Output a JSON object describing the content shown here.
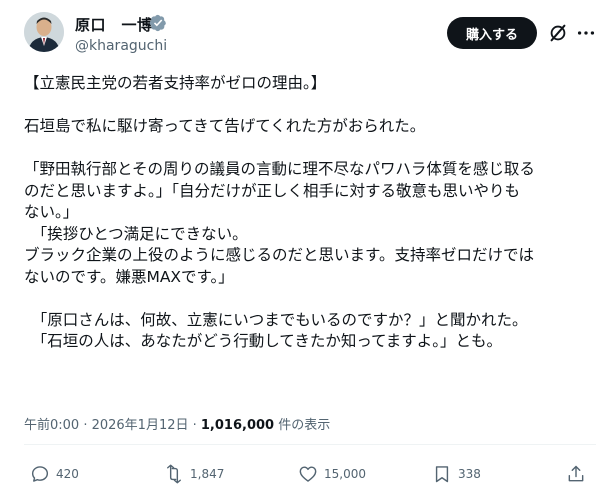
{
  "author": {
    "name": "原口　一博",
    "handle": "@kharaguchi"
  },
  "header": {
    "buy_label": "購入する"
  },
  "post": {
    "lines": [
      "【立憲民主党の若者支持率がゼロの理由。】",
      "",
      "石垣島で私に駆け寄ってきて告げてくれた方がおられた。",
      "",
      "「野田執行部とその周りの議員の言動に理不尽なパワハラ体質を感じ取る",
      "のだと思いますよ。」「自分だけが正しく相手に対する敬意も思いやりも",
      "ない。」",
      "　「挨拶ひとつ満足にできない。",
      "ブラック企業の上役のように感じるのだと思います。支持率ゼロだけでは",
      "ないのです。嫌悪MAXです。」",
      "",
      "　「原口さんは、何故、立憲にいつまでもいるのですか？」と聞かれた。",
      "　「石垣の人は、あなたがどう行動してきたか知ってますよ。」とも。"
    ]
  },
  "meta": {
    "time": "午前0:00 · 2026年1月12日 · ",
    "views": "1,016,000",
    "views_suffix": " 件の表示"
  },
  "actions": {
    "replies": "420",
    "reposts": "1,847",
    "likes": "15,000",
    "bookmarks": "338"
  },
  "colors": {
    "text": "#0f1419",
    "secondary": "#536471",
    "verified": "#829aab",
    "button_bg": "#0f1419"
  }
}
